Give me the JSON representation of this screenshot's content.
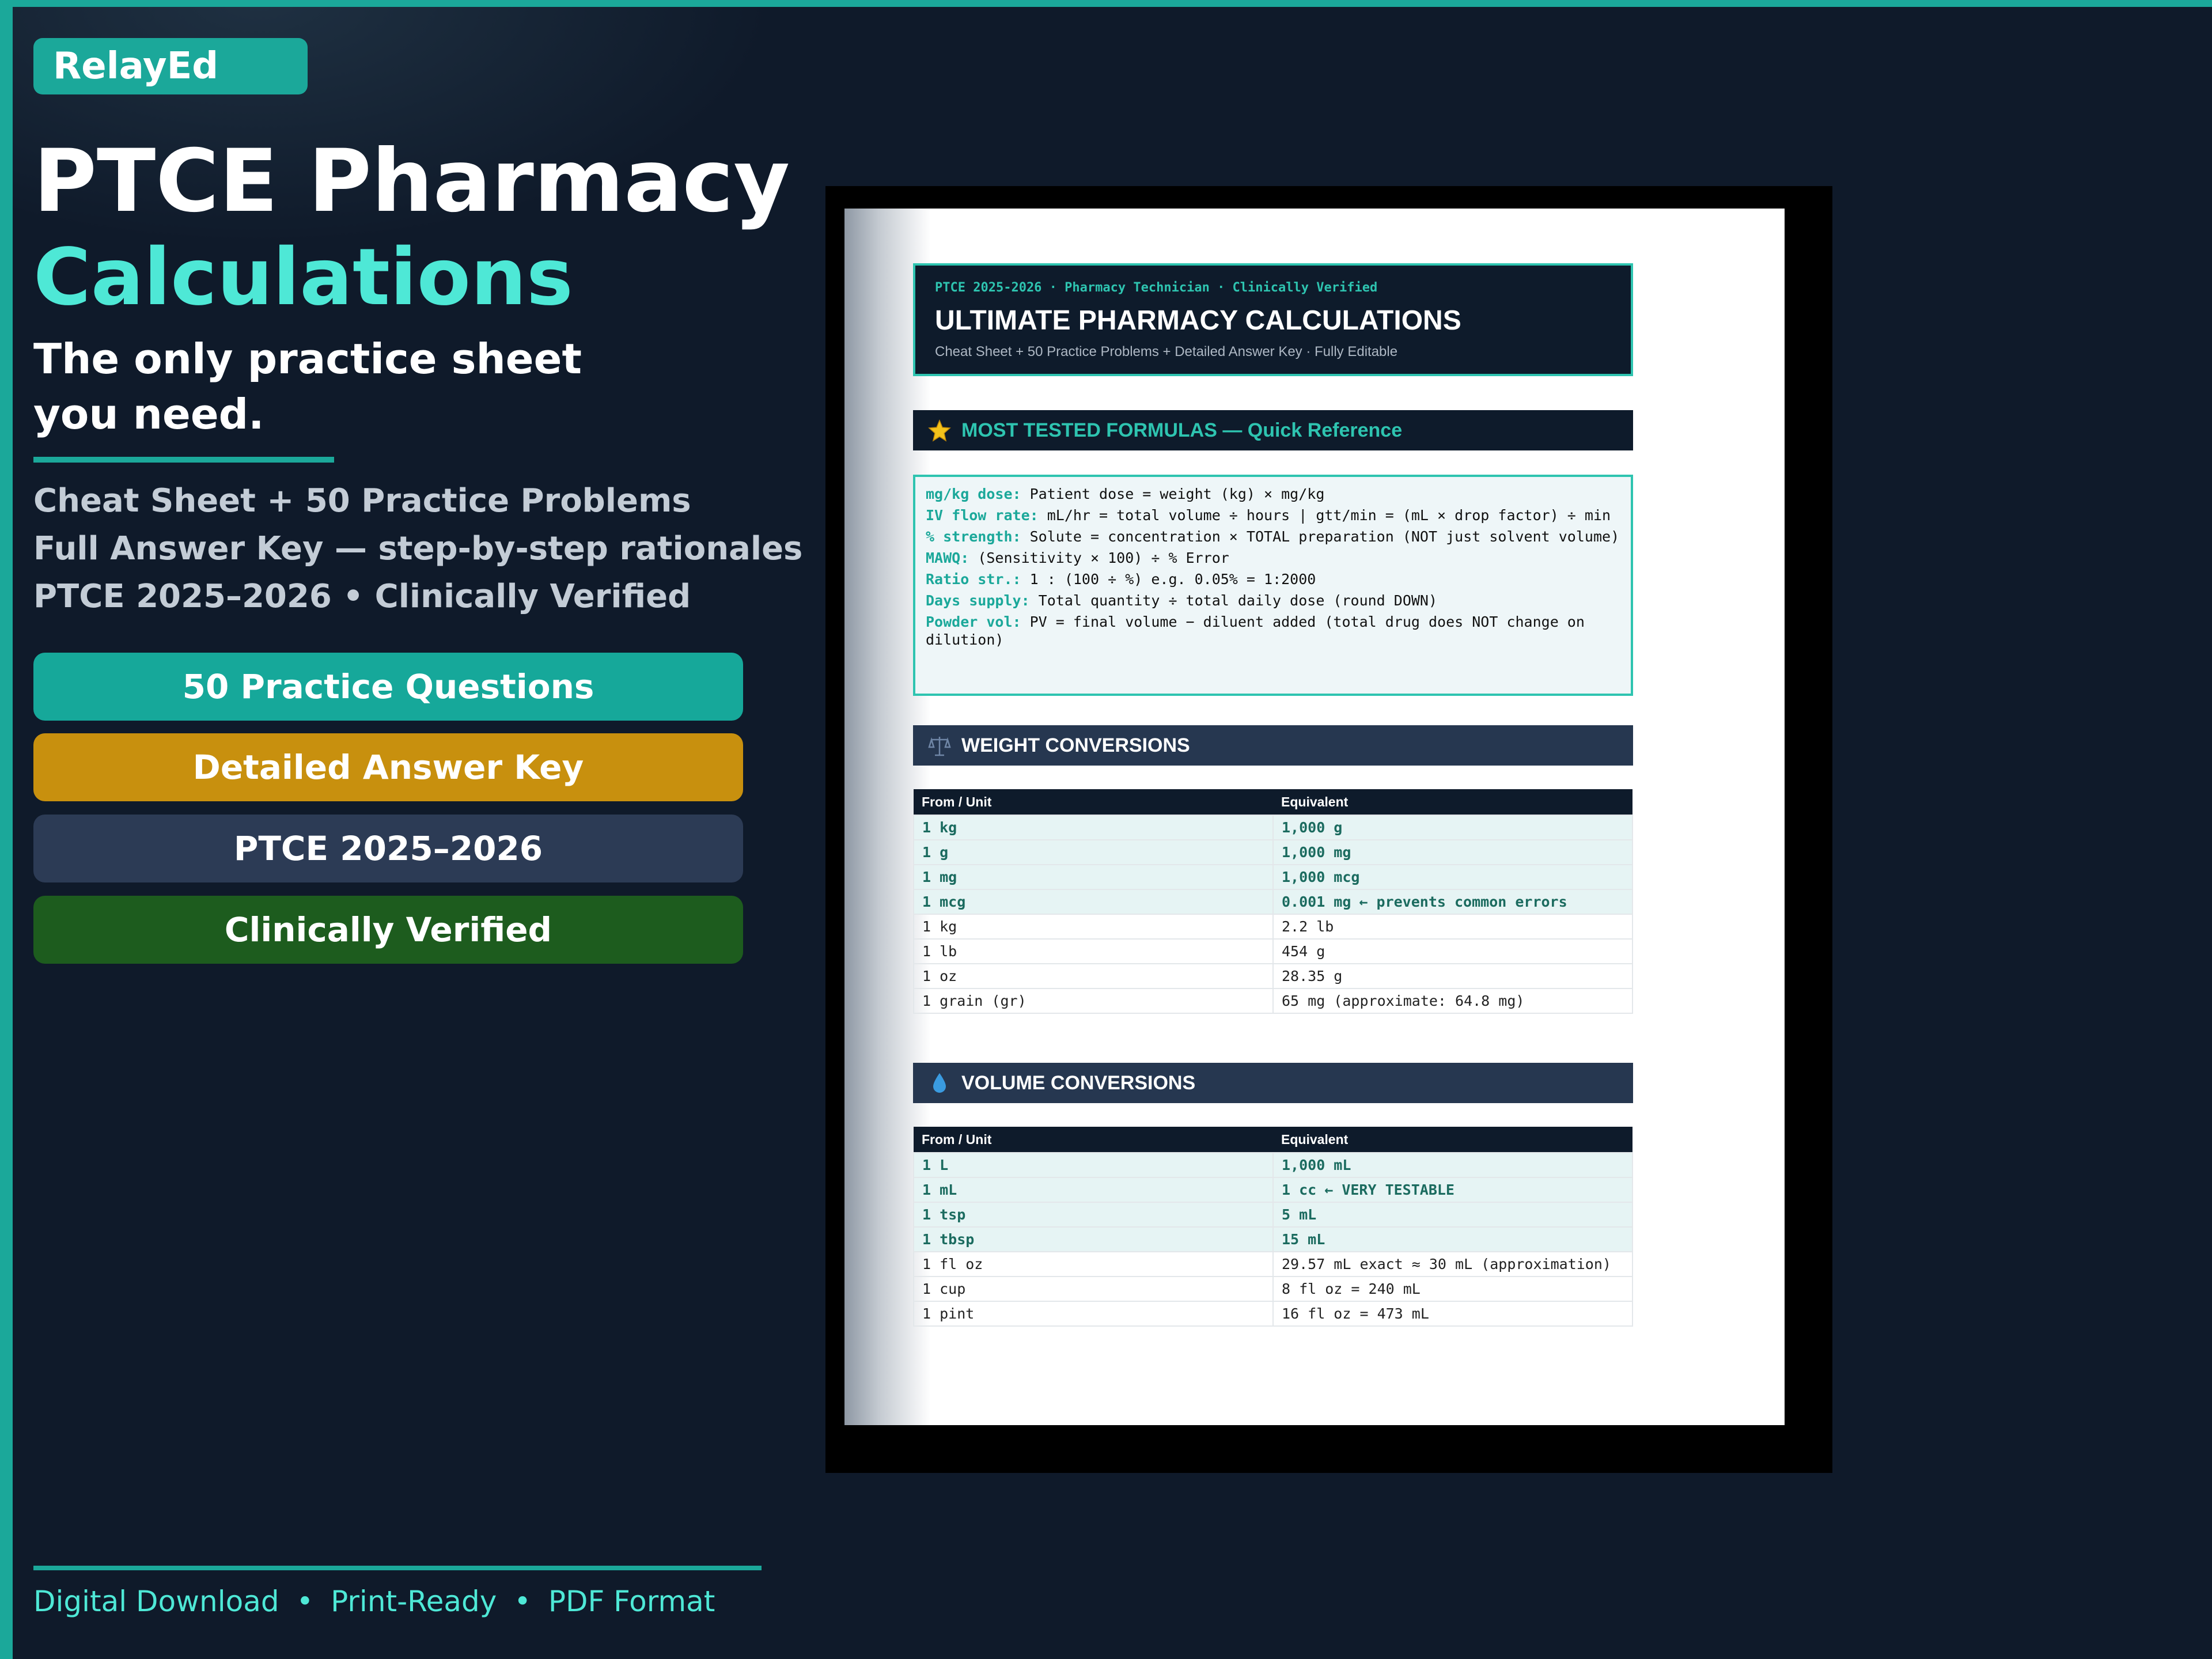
{
  "brand": "RelayEd",
  "title_line1": "PTCE Pharmacy",
  "title_line2": "Calculations",
  "tagline": [
    "The only practice sheet",
    "you need."
  ],
  "subtitles": [
    "Cheat Sheet + 50 Practice Problems",
    "Full Answer Key — step-by-step rationales",
    "PTCE 2025–2026  •  Clinically Verified"
  ],
  "pills": [
    {
      "label": "50 Practice Questions",
      "color": "#16a89a"
    },
    {
      "label": "Detailed Answer Key",
      "color": "#c8900e"
    },
    {
      "label": "PTCE 2025–2026",
      "color": "#2c3b55"
    },
    {
      "label": "Clinically Verified",
      "color": "#1d5c1e"
    }
  ],
  "footer": [
    "Digital Download",
    "Print-Ready",
    "PDF Format"
  ],
  "colors": {
    "background": "#0f1a2a",
    "accent": "#1ba89a",
    "highlight": "#4ee8d6"
  },
  "sheet": {
    "meta": "PTCE 2025-2026  ·  Pharmacy Technician  ·  Clinically Verified",
    "title": "ULTIMATE PHARMACY CALCULATIONS",
    "subtitle": "Cheat Sheet  +  50 Practice Problems  +  Detailed Answer Key  ·  Fully Editable",
    "formulas_title": "MOST TESTED FORMULAS — Quick Reference",
    "formulas_icon": "star-icon",
    "formulas": [
      {
        "key": "mg/kg dose:",
        "text": "  Patient dose = weight (kg)  ×  mg/kg"
      },
      {
        "key": "IV flow rate:",
        "text": " mL/hr = total volume ÷ hours   |   gtt/min = (mL × drop factor) ÷ min"
      },
      {
        "key": "% strength:",
        "text": "  Solute = concentration × TOTAL preparation   (NOT just solvent volume)"
      },
      {
        "key": "MAWQ:",
        "text": "         (Sensitivity × 100) ÷ % Error"
      },
      {
        "key": "Ratio str.:",
        "text": "  1 : (100 ÷ %)     e.g. 0.05% = 1:2000"
      },
      {
        "key": "Days supply:",
        "text": " Total quantity ÷ total daily dose  (round DOWN)"
      },
      {
        "key": "Powder vol:",
        "text": "  PV = final volume − diluent added   (total drug does NOT change on dilution)"
      }
    ],
    "weight": {
      "title": "WEIGHT CONVERSIONS",
      "icon": "scale-icon",
      "headers": [
        "From / Unit",
        "Equivalent"
      ],
      "rows": [
        {
          "from": "1 kg",
          "to": "1,000 g",
          "note": "",
          "hl": true
        },
        {
          "from": "1 g",
          "to": "1,000 mg",
          "note": "",
          "hl": true
        },
        {
          "from": "1 mg",
          "to": "1,000 mcg",
          "note": "",
          "hl": true
        },
        {
          "from": "1 mcg",
          "to": "0.001 mg",
          "note": "← prevents common errors",
          "hl": true
        },
        {
          "from": "1 kg",
          "to": "2.2 lb",
          "note": "",
          "hl": false
        },
        {
          "from": "1 lb",
          "to": "454 g",
          "note": "",
          "hl": false
        },
        {
          "from": "1 oz",
          "to": "28.35 g",
          "note": "",
          "hl": false
        },
        {
          "from": "1 grain (gr)",
          "to": "65 mg  (approximate: 64.8 mg)",
          "note": "",
          "hl": false
        }
      ]
    },
    "volume": {
      "title": "VOLUME CONVERSIONS",
      "icon": "droplet-icon",
      "headers": [
        "From / Unit",
        "Equivalent"
      ],
      "rows": [
        {
          "from": "1 L",
          "to": "1,000 mL",
          "note": "",
          "hl": true
        },
        {
          "from": "1 mL",
          "to": "1 cc",
          "note": "← VERY TESTABLE",
          "hl": true
        },
        {
          "from": "1 tsp",
          "to": "5 mL",
          "note": "",
          "hl": true
        },
        {
          "from": "1 tbsp",
          "to": "15 mL",
          "note": "",
          "hl": true
        },
        {
          "from": "1 fl oz",
          "to": "29.57 mL exact  ≈  30 mL (approximation)",
          "note": "",
          "hl": false
        },
        {
          "from": "1 cup",
          "to": "8 fl oz  =  240 mL",
          "note": "",
          "hl": false
        },
        {
          "from": "1 pint",
          "to": "16 fl oz  =  473 mL",
          "note": "",
          "hl": false
        }
      ]
    }
  }
}
